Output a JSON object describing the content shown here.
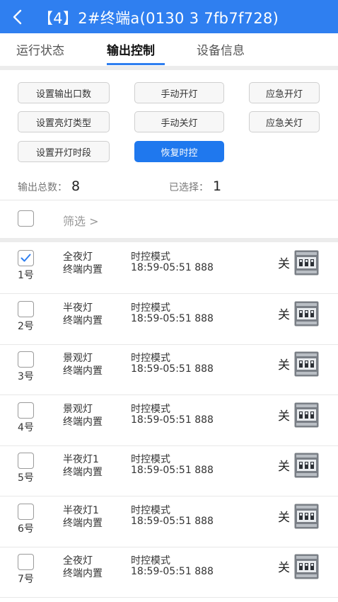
{
  "header": {
    "title": "【4】2#终端a(0130 3       7fb7f728)"
  },
  "tabs": [
    {
      "label": "运行状态",
      "active": false
    },
    {
      "label": "输出控制",
      "active": true
    },
    {
      "label": "设备信息",
      "active": false
    }
  ],
  "buttons": {
    "set_output_count": "设置输出口数",
    "manual_on": "手动开灯",
    "emergency_on": "应急开灯",
    "set_light_type": "设置亮灯类型",
    "manual_off": "手动关灯",
    "emergency_off": "应急关灯",
    "set_on_period": "设置开灯时段",
    "restore_time_control": "恢复时控"
  },
  "stats": {
    "total_label": "输出总数：",
    "total_value": "8",
    "selected_label": "已选择：",
    "selected_value": "1"
  },
  "filter": {
    "label": "筛选 >"
  },
  "outputs": [
    {
      "number": "1号",
      "checked": true,
      "name": "全夜灯",
      "source": "终端内置",
      "mode": "时控模式",
      "time": "18:59-05:51 888",
      "state": "关",
      "icon": "switch-icon"
    },
    {
      "number": "2号",
      "checked": false,
      "name": "半夜灯",
      "source": "终端内置",
      "mode": "时控模式",
      "time": "18:59-05:51 888",
      "state": "关",
      "icon": "switch-icon"
    },
    {
      "number": "3号",
      "checked": false,
      "name": "景观灯",
      "source": "终端内置",
      "mode": "时控模式",
      "time": "18:59-05:51 888",
      "state": "关",
      "icon": "switch-icon"
    },
    {
      "number": "4号",
      "checked": false,
      "name": "景观灯",
      "source": "终端内置",
      "mode": "时控模式",
      "time": "18:59-05:51 888",
      "state": "关",
      "icon": "switch-icon"
    },
    {
      "number": "5号",
      "checked": false,
      "name": "半夜灯1",
      "source": "终端内置",
      "mode": "时控模式",
      "time": "18:59-05:51 888",
      "state": "关",
      "icon": "switch-icon"
    },
    {
      "number": "6号",
      "checked": false,
      "name": "半夜灯1",
      "source": "终端内置",
      "mode": "时控模式",
      "time": "18:59-05:51 888",
      "state": "关",
      "icon": "switch-icon"
    },
    {
      "number": "7号",
      "checked": false,
      "name": "全夜灯",
      "source": "终端内置",
      "mode": "时控模式",
      "time": "18:59-05:51 888",
      "state": "关",
      "icon": "switch-icon"
    }
  ],
  "colors": {
    "accent": "#2f7ff0",
    "primary_button": "#1f78ee",
    "check": "#2f7ff0"
  }
}
